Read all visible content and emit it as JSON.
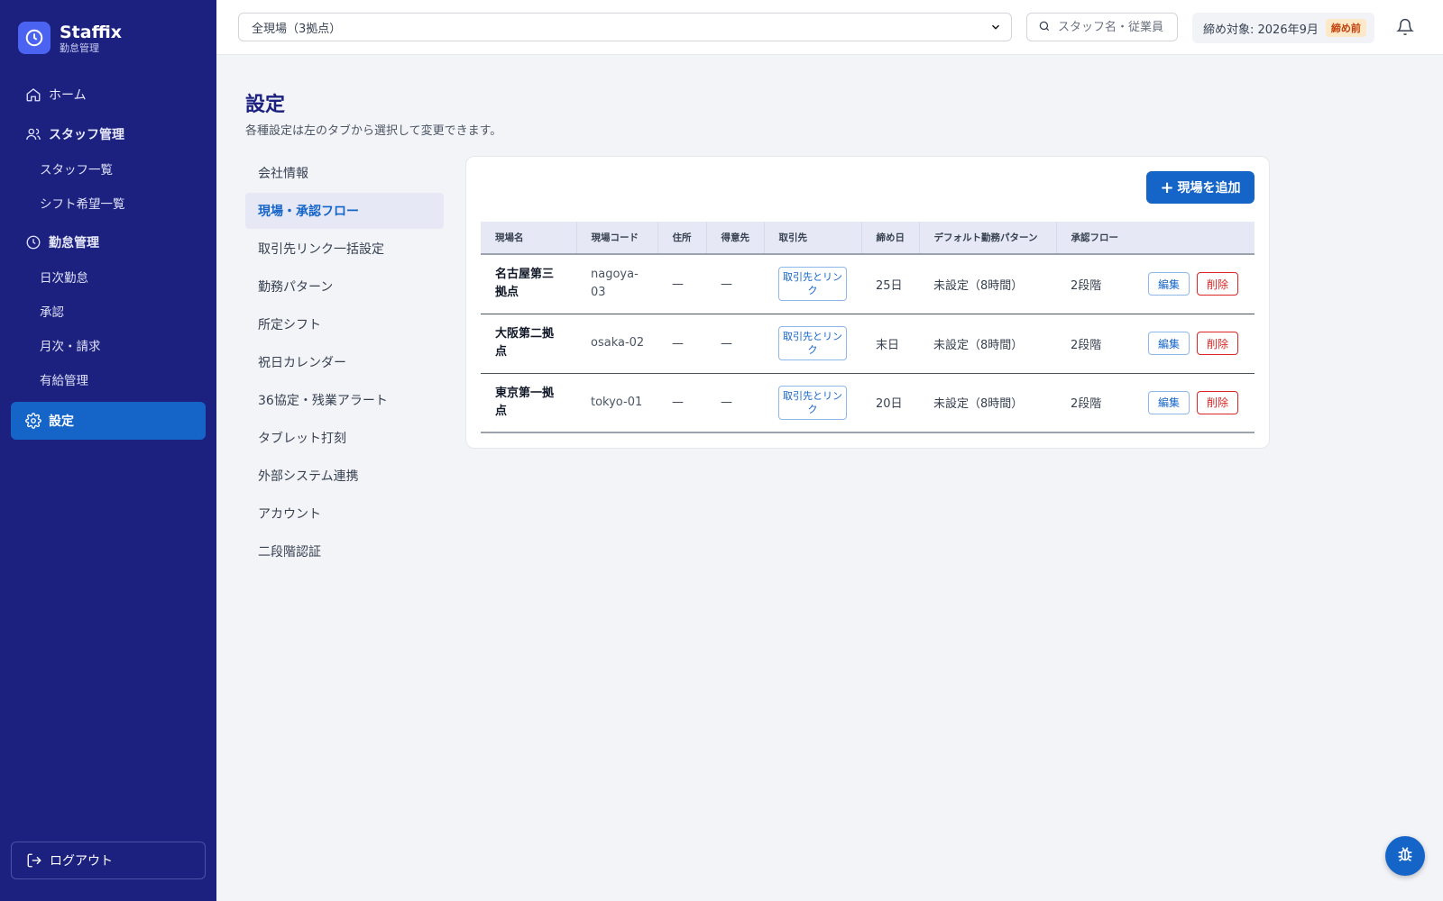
{
  "brand": {
    "name": "Staffix",
    "subtitle": "勤怠管理"
  },
  "sidebar": {
    "items": [
      {
        "label": "ホーム",
        "icon": "home-icon"
      },
      {
        "label": "スタッフ管理",
        "icon": "users-icon"
      },
      {
        "label": "スタッフ一覧"
      },
      {
        "label": "シフト希望一覧"
      },
      {
        "label": "勤怠管理",
        "icon": "clock-icon"
      },
      {
        "label": "日次勤怠"
      },
      {
        "label": "承認"
      },
      {
        "label": "月次・請求"
      },
      {
        "label": "有給管理"
      },
      {
        "label": "設定",
        "icon": "gear-icon"
      }
    ],
    "logout": "ログアウト"
  },
  "topbar": {
    "site_select": "全現場（3拠点）",
    "search_placeholder": "スタッフ名・従業員",
    "closing_label": "締め対象: 2026年9月",
    "closing_badge": "締め前"
  },
  "page": {
    "title": "設定",
    "description": "各種設定は左のタブから選択して変更できます。"
  },
  "tabs": [
    "会社情報",
    "現場・承認フロー",
    "取引先リンク一括設定",
    "勤務パターン",
    "所定シフト",
    "祝日カレンダー",
    "36協定・残業アラート",
    "タブレット打刻",
    "外部システム連携",
    "アカウント",
    "二段階認証"
  ],
  "card": {
    "add_button": "現場を追加",
    "columns": [
      "現場名",
      "現場コード",
      "住所",
      "得意先",
      "取引先",
      "締め日",
      "デフォルト勤務パターン",
      "承認フロー"
    ],
    "rows": [
      {
        "name": "名古屋第三拠点",
        "code": "nagoya-03",
        "address": "—",
        "customer": "—",
        "link": "取引先とリンク",
        "closing_day": "25日",
        "pattern": "未設定（8時間）",
        "flow": "2段階",
        "edit": "編集",
        "delete": "削除"
      },
      {
        "name": "大阪第二拠点",
        "code": "osaka-02",
        "address": "—",
        "customer": "—",
        "link": "取引先とリンク",
        "closing_day": "末日",
        "pattern": "未設定（8時間）",
        "flow": "2段階",
        "edit": "編集",
        "delete": "削除"
      },
      {
        "name": "東京第一拠点",
        "code": "tokyo-01",
        "address": "—",
        "customer": "—",
        "link": "取引先とリンク",
        "closing_day": "20日",
        "pattern": "未設定（8時間）",
        "flow": "2段階",
        "edit": "編集",
        "delete": "削除"
      }
    ]
  },
  "colors": {
    "sidebar": "#1c2180",
    "accent": "#1565c8",
    "danger": "#dc2626"
  }
}
